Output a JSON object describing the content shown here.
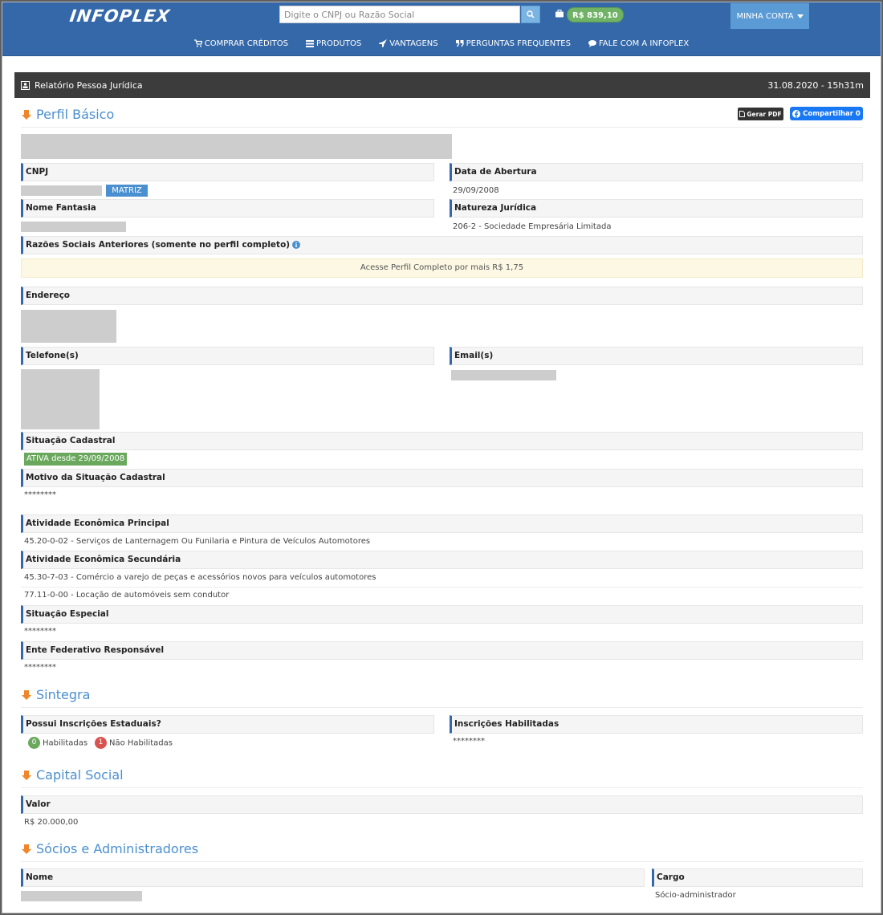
{
  "header": {
    "logo": "INFOPLEX",
    "search_placeholder": "Digite o CNPJ ou Razão Social",
    "balance": "R$ 839,10",
    "account_label": "MINHA CONTA",
    "nav": [
      {
        "label": "COMPRAR CRÉDITOS",
        "icon": "cart-icon"
      },
      {
        "label": "PRODUTOS",
        "icon": "list-icon"
      },
      {
        "label": "VANTAGENS",
        "icon": "rocket-icon"
      },
      {
        "label": "PERGUNTAS FREQUENTES",
        "icon": "quote-icon"
      },
      {
        "label": "FALE COM A INFOPLEX",
        "icon": "chat-icon"
      }
    ]
  },
  "report": {
    "title": "Relatório Pessoa Jurídica",
    "datetime": "31.08.2020 - 15h31m"
  },
  "actions": {
    "pdf_label": "Gerar PDF",
    "share_label": "Compartilhar 0"
  },
  "perfil": {
    "title": "Perfil Básico",
    "cnpj_label": "CNPJ",
    "matriz_badge": "MATRIZ",
    "abertura_label": "Data de Abertura",
    "abertura_value": "29/09/2008",
    "fantasia_label": "Nome Fantasia",
    "natureza_label": "Natureza Jurídica",
    "natureza_value": "206-2 - Sociedade Empresária Limitada",
    "razoes_label": "Razões Sociais Anteriores (somente no perfil completo)",
    "notice": "Acesse Perfil Completo por mais R$ 1,75",
    "endereco_label": "Endereço",
    "telefone_label": "Telefone(s)",
    "email_label": "Email(s)",
    "situacao_label": "Situação Cadastral",
    "situacao_badge": "ATIVA desde 29/09/2008",
    "motivo_label": "Motivo da Situação Cadastral",
    "motivo_value": "********",
    "atividade_principal_label": "Atividade Econômica Principal",
    "atividade_principal_value": "45.20-0-02 - Serviços de Lanternagem Ou Funilaria e Pintura de Veículos Automotores",
    "atividade_secundaria_label": "Atividade Econômica Secundária",
    "atividade_secundaria_values": [
      "45.30-7-03 - Comércio a varejo de peças e acessórios novos para veículos automotores",
      "77.11-0-00 - Locação de automóveis sem condutor"
    ],
    "situacao_especial_label": "Situação Especial",
    "situacao_especial_value": "********",
    "ente_label": "Ente Federativo Responsável",
    "ente_value": "********"
  },
  "sintegra": {
    "title": "Sintegra",
    "inscricoes_label": "Possui Inscrições Estaduais?",
    "habilitadas_count": "0",
    "habilitadas_label": "Habilitadas",
    "nao_habilitadas_count": "1",
    "nao_habilitadas_label": "Não Habilitadas",
    "inscricoes_hab_label": "Inscrições Habilitadas",
    "inscricoes_hab_value": "********"
  },
  "capital": {
    "title": "Capital Social",
    "valor_label": "Valor",
    "valor": "R$ 20.000,00"
  },
  "socios": {
    "title": "Sócios e Administradores",
    "nome_label": "Nome",
    "cargo_label": "Cargo",
    "cargo_value": "Sócio-administrador"
  },
  "colors": {
    "header_blue": "#3468a8",
    "accent_blue": "#4a8fcf",
    "arrow_orange": "#f0862a",
    "balance_green": "#70b266",
    "status_green": "#6aa85e",
    "danger_red": "#d9534f"
  }
}
